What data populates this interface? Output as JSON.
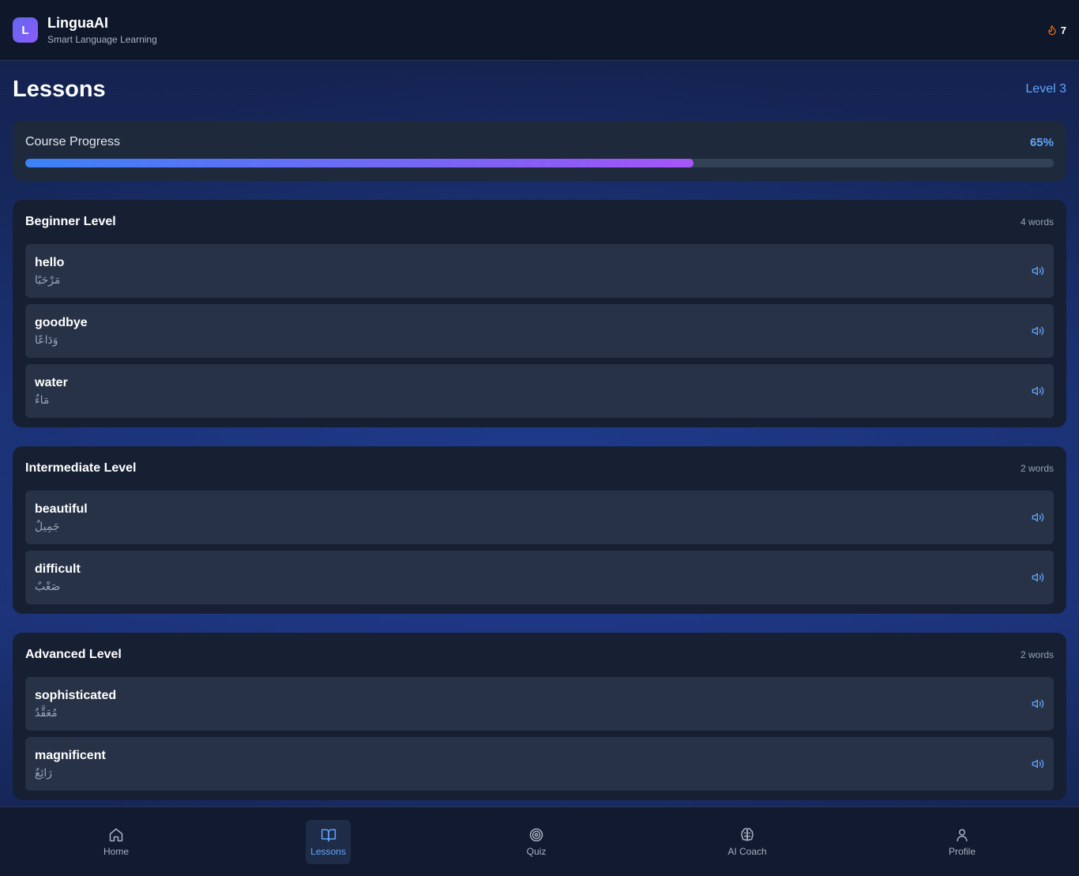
{
  "app": {
    "logo_letter": "L",
    "name": "LinguaAI",
    "subtitle": "Smart Language Learning",
    "streak": "7"
  },
  "page": {
    "title": "Lessons",
    "level": "Level 3"
  },
  "progress": {
    "label": "Course Progress",
    "percent_text": "65%",
    "value": 0.65
  },
  "sections": [
    {
      "title": "Beginner Level",
      "count": "4 words",
      "words": [
        {
          "en": "hello",
          "ar": "مَرْحَبًا"
        },
        {
          "en": "goodbye",
          "ar": "وَدَاعًا"
        },
        {
          "en": "water",
          "ar": "مَاءٌ"
        }
      ]
    },
    {
      "title": "Intermediate Level",
      "count": "2 words",
      "words": [
        {
          "en": "beautiful",
          "ar": "جَمِيلٌ"
        },
        {
          "en": "difficult",
          "ar": "صَعْبٌ"
        }
      ]
    },
    {
      "title": "Advanced Level",
      "count": "2 words",
      "words": [
        {
          "en": "sophisticated",
          "ar": "مُعَقَّدٌ"
        },
        {
          "en": "magnificent",
          "ar": "رَائِعٌ"
        }
      ]
    }
  ],
  "nav": [
    {
      "label": "Home",
      "icon": "home-icon",
      "active": false
    },
    {
      "label": "Lessons",
      "icon": "book-icon",
      "active": true
    },
    {
      "label": "Quiz",
      "icon": "target-icon",
      "active": false
    },
    {
      "label": "AI Coach",
      "icon": "brain-icon",
      "active": false
    },
    {
      "label": "Profile",
      "icon": "user-icon",
      "active": false
    }
  ],
  "colors": {
    "accent": "#60a5fa",
    "streak_flame": "#f97316",
    "progress_start": "#3b82f6",
    "progress_end": "#a855f7"
  }
}
